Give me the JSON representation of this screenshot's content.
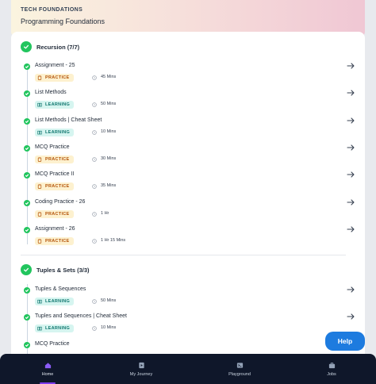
{
  "header": {
    "kicker": "TECH FOUNDATIONS",
    "title": "Programming Foundations"
  },
  "sections": [
    {
      "label": "Recursion (7/7)",
      "items": [
        {
          "name": "Assignment - 25",
          "badge": "PRACTICE",
          "duration": "45 Mins"
        },
        {
          "name": "List Methods",
          "badge": "LEARNING",
          "duration": "50 Mins"
        },
        {
          "name": "List Methods | Cheat Sheet",
          "badge": "LEARNING",
          "duration": "10 Mins"
        },
        {
          "name": "MCQ Practice",
          "badge": "PRACTICE",
          "duration": "30 Mins"
        },
        {
          "name": "MCQ Practice II",
          "badge": "PRACTICE",
          "duration": "35 Mins"
        },
        {
          "name": "Coding Practice - 26",
          "badge": "PRACTICE",
          "duration": "1 Hr"
        },
        {
          "name": "Assignment - 26",
          "badge": "PRACTICE",
          "duration": "1 Hr 15 Mins"
        }
      ]
    },
    {
      "label": "Tuples & Sets (3/3)",
      "items": [
        {
          "name": "Tuples & Sequences",
          "badge": "LEARNING",
          "duration": "50 Mins"
        },
        {
          "name": "Tuples and Sequences | Cheat Sheet",
          "badge": "LEARNING",
          "duration": "10 Mins"
        },
        {
          "name": "MCQ Practice",
          "badge": "",
          "duration": ""
        }
      ]
    }
  ],
  "help_label": "Help",
  "nav": [
    {
      "label": "Home",
      "icon": "home-icon",
      "active": true
    },
    {
      "label": "My Journey",
      "icon": "journey-icon",
      "active": false
    },
    {
      "label": "Playground",
      "icon": "terminal-icon",
      "active": false
    },
    {
      "label": "Jobs",
      "icon": "jobs-icon",
      "active": false
    }
  ],
  "colors": {
    "complete": "#22c55e",
    "practice_bg": "#fdf1cf",
    "practice_text": "#b45309",
    "learning_bg": "#d6f5f0",
    "learning_text": "#0f766e",
    "help": "#1d7bdf",
    "nav_bg": "#0f172a",
    "nav_active": "#7c3aed"
  }
}
